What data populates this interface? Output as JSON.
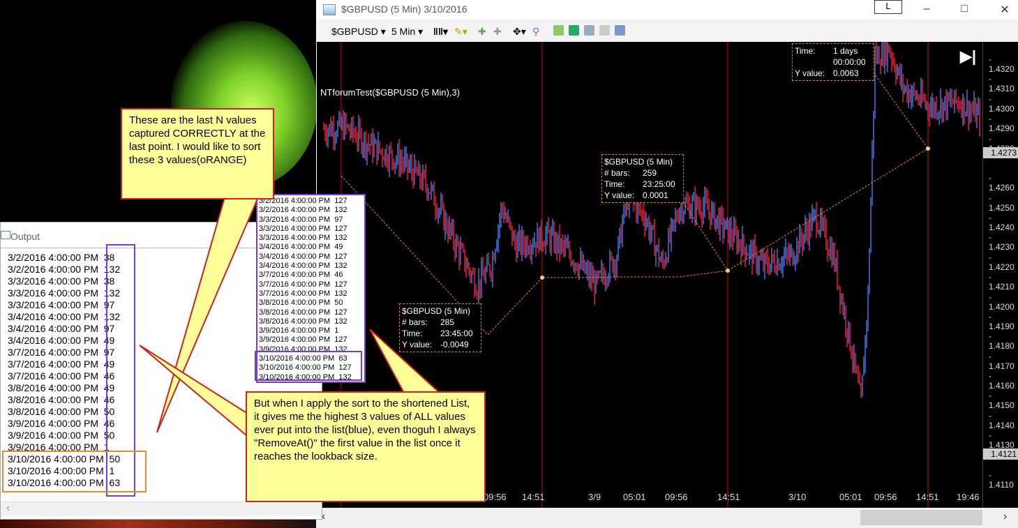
{
  "chart_window": {
    "title": "$GBPUSD (5 Min)  3/10/2016",
    "title_button": "L",
    "toolbar": {
      "instrument": "$GBPUSD",
      "interval": "5 Min"
    },
    "indicator_label": "NTforumTest($GBPUSD (5 Min),3)",
    "price_axis": [
      "1.4320",
      "1.4310",
      "1.4300",
      "1.4290",
      "1.4280",
      "1.4260",
      "1.4250",
      "1.4240",
      "1.4230",
      "1.4220",
      "1.4210",
      "1.4200",
      "1.4190",
      "1.4180",
      "1.4170",
      "1.4160",
      "1.4150",
      "1.4140",
      "1.4130",
      "1.4110"
    ],
    "price_badges": [
      "1.4273",
      "1.4121"
    ],
    "time_axis": [
      "09:56",
      "14:51",
      "3/9",
      "05:01",
      "09:56",
      "14:51",
      "3/10",
      "05:01",
      "09:56",
      "14:51",
      "19:46"
    ],
    "info_boxes": [
      {
        "name": "$GBPUSD (5 Min)",
        "rows": [
          {
            "k": "# bars:",
            "v": "285"
          },
          {
            "k": "Time:",
            "v": "23:45:00"
          },
          {
            "k": "Y value:",
            "v": "-0.0049"
          }
        ]
      },
      {
        "name": "$GBPUSD (5 Min)",
        "rows": [
          {
            "k": "# bars:",
            "v": "259"
          },
          {
            "k": "Time:",
            "v": "23:25:00"
          },
          {
            "k": "Y value:",
            "v": "0.0001"
          }
        ]
      },
      {
        "name": "",
        "rows": [
          {
            "k": "Time:",
            "v": "1 days"
          },
          {
            "k": "",
            "v": "00:00:00"
          },
          {
            "k": "Y value:",
            "v": "0.0063"
          }
        ]
      }
    ],
    "colors": {
      "up_bar": "#3a6fd8",
      "down_bar": "#d81e2c",
      "session_line": "#cc1111",
      "dashed": "#e08a2a"
    }
  },
  "output_window": {
    "title": "Output",
    "lines": [
      "3/2/2016 4:00:00 PM  38",
      "3/2/2016 4:00:00 PM  132",
      "3/3/2016 4:00:00 PM  38",
      "3/3/2016 4:00:00 PM  132",
      "3/3/2016 4:00:00 PM  97",
      "3/4/2016 4:00:00 PM  132",
      "3/4/2016 4:00:00 PM  97",
      "3/4/2016 4:00:00 PM  49",
      "3/7/2016 4:00:00 PM  97",
      "3/7/2016 4:00:00 PM  49",
      "3/7/2016 4:00:00 PM  46",
      "3/8/2016 4:00:00 PM  49",
      "3/8/2016 4:00:00 PM  46",
      "3/8/2016 4:00:00 PM  50",
      "3/9/2016 4:00:00 PM  46",
      "3/9/2016 4:00:00 PM  50",
      "3/9/2016 4:00:00 PM  1",
      "3/10/2016 4:00:00 PM  50",
      "3/10/2016 4:00:00 PM  1",
      "3/10/2016 4:00:00 PM  63"
    ]
  },
  "popup_list": {
    "lines": [
      "3/2/2016 4:00:00 PM  127",
      "3/2/2016 4:00:00 PM  132",
      "3/3/2016 4:00:00 PM  97",
      "3/3/2016 4:00:00 PM  127",
      "3/3/2016 4:00:00 PM  132",
      "3/4/2016 4:00:00 PM  49",
      "3/4/2016 4:00:00 PM  127",
      "3/4/2016 4:00:00 PM  132",
      "3/7/2016 4:00:00 PM  46",
      "3/7/2016 4:00:00 PM  127",
      "3/7/2016 4:00:00 PM  132",
      "3/8/2016 4:00:00 PM  50",
      "3/8/2016 4:00:00 PM  127",
      "3/8/2016 4:00:00 PM  132",
      "3/9/2016 4:00:00 PM  1",
      "3/9/2016 4:00:00 PM  127",
      "3/9/2016 4:00:00 PM  132",
      "3/10/2016 4:00:00 PM  63",
      "3/10/2016 4:00:00 PM  127",
      "3/10/2016 4:00:00 PM  132"
    ]
  },
  "callouts": {
    "top": "These are the last N values captured CORRECTLY at the last point.  I would like to sort these 3 values(oRANGE)",
    "bottom": "But when I apply the sort to the shortened List, it gives me the highest 3 values of ALL values ever put into the list(blue), even thoguh I always \"RemoveAt()\" the first value in the list once it reaches the lookback size."
  }
}
